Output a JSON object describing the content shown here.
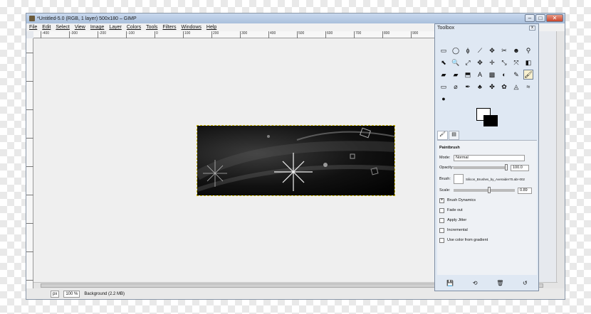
{
  "window": {
    "title": "*Untitled-5.0 (RGB, 1 layer) 500x180 – GIMP",
    "min_label": "–",
    "max_label": "□",
    "close_label": "✕"
  },
  "menu": [
    "File",
    "Edit",
    "Select",
    "View",
    "Image",
    "Layer",
    "Colors",
    "Tools",
    "Filters",
    "Windows",
    "Help"
  ],
  "hruler": [
    "-400",
    "-300",
    "-200",
    "-100",
    "0",
    "100",
    "200",
    "300",
    "400",
    "500",
    "600",
    "700",
    "800",
    "900"
  ],
  "status": {
    "unit": "px",
    "zoom": "100 %",
    "layer_info": "Background (2.2 MB)"
  },
  "toolbox": {
    "title": "Toolbox",
    "close_label": "x",
    "tools": [
      "▭",
      "◯",
      "ϕ",
      "⟋",
      "✥",
      "✂",
      "☻",
      "⚲",
      "⬉",
      "🔍",
      "⤢",
      "✥",
      "✛",
      "⤡",
      "⤧",
      "◧",
      "▰",
      "▰",
      "⬒",
      "A",
      "▩",
      "◐",
      "✎",
      "🖌",
      "▭",
      "⌀",
      "✒",
      "♣",
      "✤",
      "✿",
      "◬",
      "≈",
      "●"
    ],
    "selected_tool_index": 23,
    "tool_options_title": "Paintbrush",
    "mode_label": "Mode:",
    "mode_value": "Normal",
    "opacity_label": "Opacity:",
    "opacity_value": "100.0",
    "brush_label": "Brush:",
    "brush_value": "Silicon_Brushes_by_Averaider70.abr-002",
    "scale_label": "Scale:",
    "scale_value": "0.89",
    "dynamics_label": "Brush Dynamics",
    "checkboxes": [
      "Fade out",
      "Apply Jitter",
      "Incremental",
      "Use color from gradient"
    ]
  }
}
